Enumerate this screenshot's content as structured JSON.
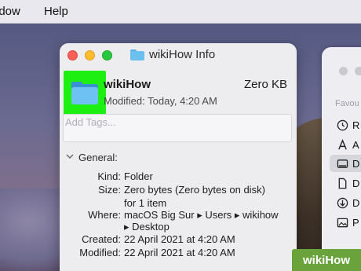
{
  "menubar": {
    "items": [
      "ndow",
      "Help"
    ]
  },
  "info_window": {
    "title": "wikiHow Info",
    "name": "wikiHow",
    "size": "Zero KB",
    "modified_line": "Modified: Today, 4:20 AM",
    "tags_placeholder": "Add Tags...",
    "general_label": "General:",
    "general": {
      "kind_label": "Kind:",
      "kind": "Folder",
      "size_label": "Size:",
      "size_line1": "Zero bytes (Zero bytes on disk)",
      "size_line2": "for 1 item",
      "where_label": "Where:",
      "where_line1": "macOS Big Sur ▸ Users ▸ wikihow",
      "where_line2": "▸ Desktop",
      "created_label": "Created:",
      "created": "22 April 2021 at 4:20 AM",
      "modified_label": "Modified:",
      "modified": "22 April 2021 at 4:20 AM"
    }
  },
  "finder_sidebar": {
    "section": "Favou",
    "items": [
      {
        "icon": "clock-icon",
        "label": "R"
      },
      {
        "icon": "applications-icon",
        "label": "A"
      },
      {
        "icon": "desktop-icon",
        "label": "D",
        "selected": true
      },
      {
        "icon": "document-icon",
        "label": "D"
      },
      {
        "icon": "download-icon",
        "label": "D"
      },
      {
        "icon": "pictures-icon",
        "label": "P"
      }
    ]
  },
  "watermark": "wikiHow",
  "colors": {
    "highlight": "#1eef12",
    "folder": "#6dc2f3"
  }
}
